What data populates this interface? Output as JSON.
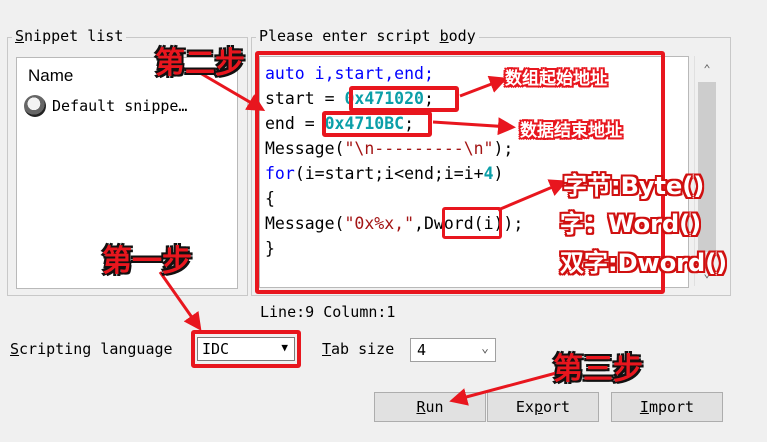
{
  "snippet_panel": {
    "title_prefix": "S",
    "title_rest": "nippet list",
    "column_header": "Name",
    "items": [
      {
        "label": "Default snippe…"
      }
    ]
  },
  "editor_panel": {
    "title_prefix": "Please enter script ",
    "title_accel": "b",
    "title_suffix": "ody",
    "code": {
      "l1": "auto i,start,end;",
      "l2a": "start = ",
      "l2b": "0x471020",
      "l2c": ";",
      "l3a": "end = ",
      "l3b": "0x4710BC",
      "l3c": ";",
      "l4a": "Message(",
      "l4b": "\"\\n---------\\n\"",
      "l4c": ");",
      "l5a": "for",
      "l5b": "(i=start;i<end;i=i+",
      "l5c": "4",
      "l5d": ")",
      "l6": "{",
      "l7a": "Message(",
      "l7b": "\"0x%x,\"",
      "l7c": ",Dword(i));",
      "l8": "}"
    },
    "status": "Line:9  Column:1"
  },
  "controls": {
    "lang_label_accel": "S",
    "lang_label_rest": "cripting language",
    "lang_value": "IDC",
    "tab_label_accel": "T",
    "tab_label_rest": "ab size",
    "tab_value": "4",
    "run_accel": "R",
    "run_rest": "un",
    "export_pre": "Ex",
    "export_accel": "p",
    "export_post": "ort",
    "import_accel": "I",
    "import_rest": "mport"
  },
  "annotations": {
    "step1": "第一步",
    "step2": "第二步",
    "step3": "第三步",
    "start_addr": "数组起始地址",
    "end_addr": "数据结束地址",
    "byte": "字节:Byte()",
    "word": "字：Word()",
    "dword": "双字:Dword()"
  },
  "colors": {
    "annotation_red": "#e8161e",
    "keyword_blue": "#0000ff",
    "number_teal": "#0b9fa8",
    "string_red": "#a31515"
  }
}
